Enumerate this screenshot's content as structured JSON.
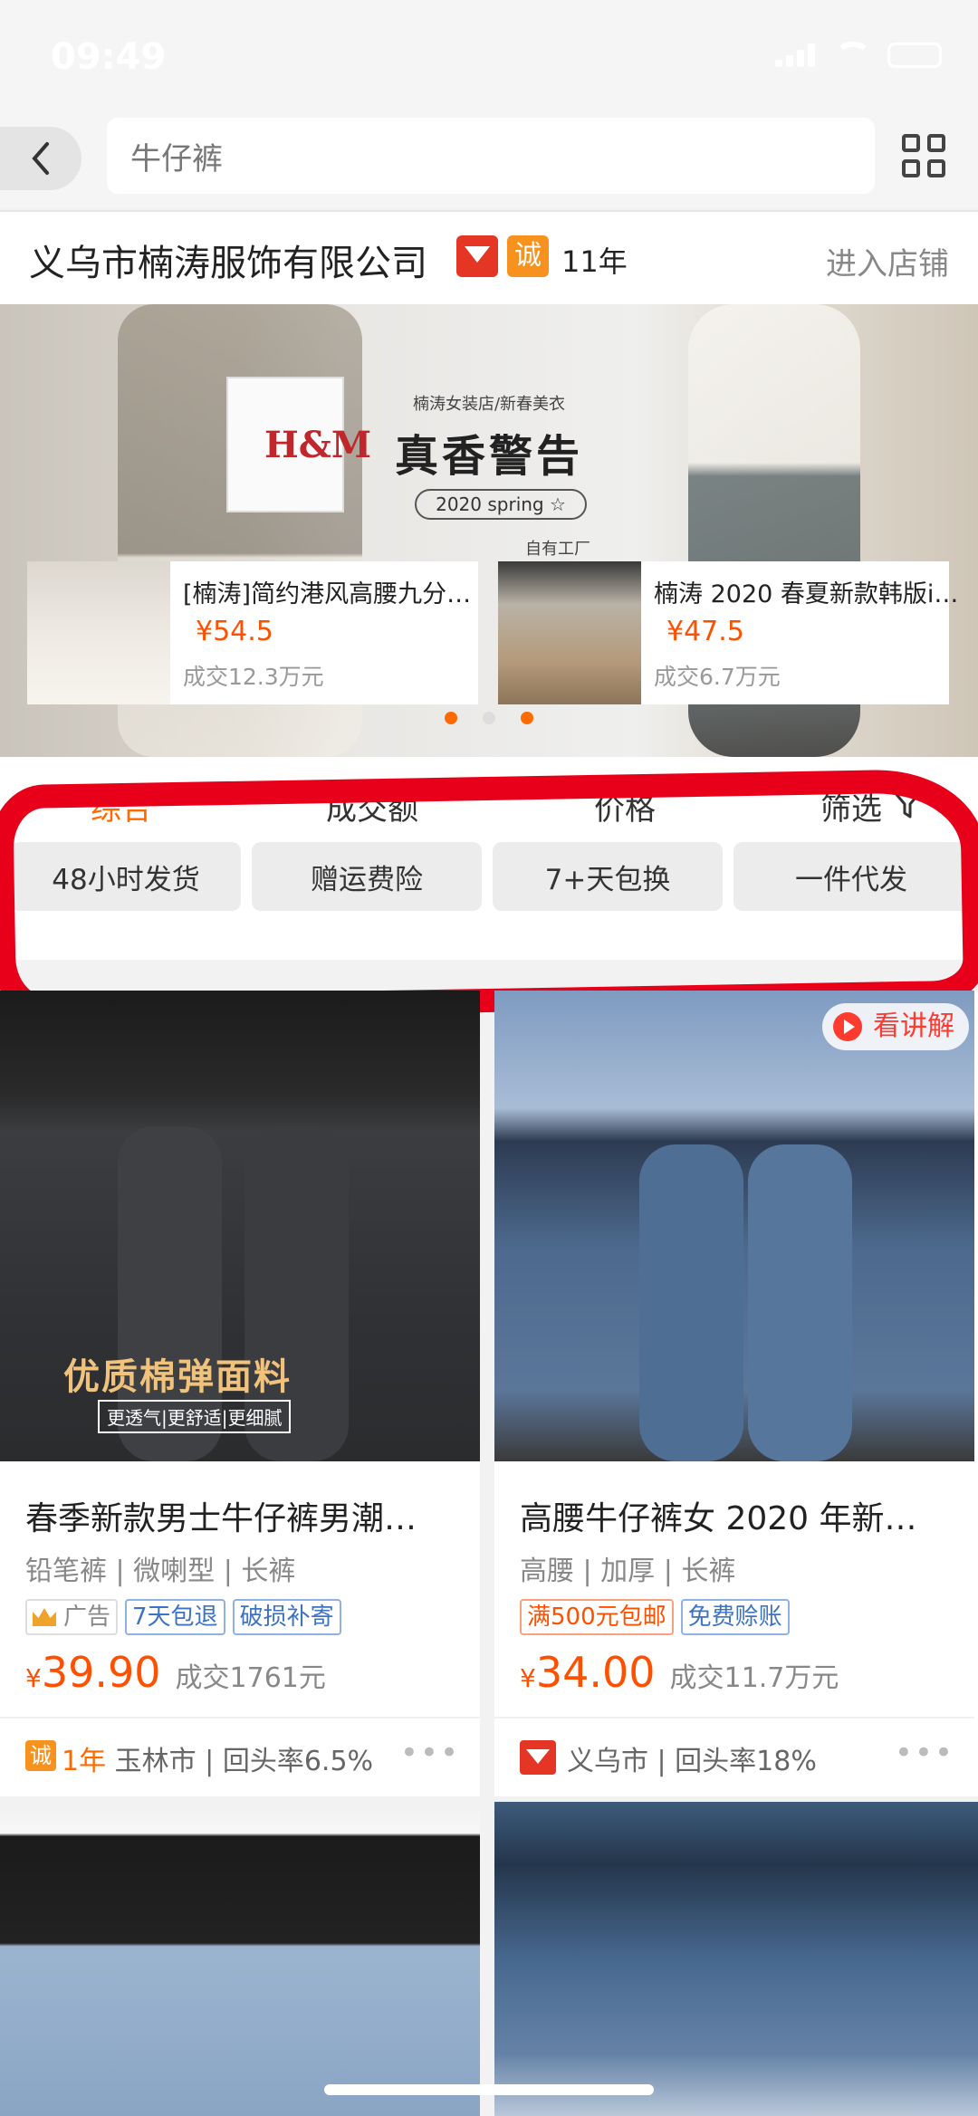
{
  "status_bar": {
    "time": "09:49"
  },
  "search": {
    "value": "牛仔裤"
  },
  "shop": {
    "name": "义乌市楠涛服饰有限公司",
    "cheng_badge": "诚",
    "years": "11年",
    "enter_label": "进入店铺"
  },
  "banner": {
    "subtitle": "楠涛女装店/新春美衣",
    "title": "真香警告",
    "pill": "2020 spring ☆",
    "extra": "自有工厂",
    "bag_brand": "H&M",
    "products": [
      {
        "title": "[楠涛]简约港风高腰九分…",
        "price": "¥54.5",
        "deal": "成交12.3万元"
      },
      {
        "title": "楠涛 2020 春夏新款韩版i…",
        "price": "¥47.5",
        "deal": "成交6.7万元"
      }
    ],
    "carousel_pages": 3,
    "carousel_active_index": 0
  },
  "sort_tabs": [
    "综合",
    "成交额",
    "价格",
    "筛选"
  ],
  "filter_chips": [
    "48小时发货",
    "赠运费险",
    "7+天包换",
    "一件代发"
  ],
  "products": [
    {
      "title": "春季新款男士牛仔裤男潮…",
      "attrs": "铅笔裤 | 微喇型 | 长裤",
      "image_text": "优质棉弹面料",
      "image_subtext": "更透气|更舒适|更细腻",
      "tags": [
        "广告",
        "7天包退",
        "破损补寄"
      ],
      "price_symbol": "¥",
      "price": "39.90",
      "deal": "成交1761元",
      "seller_years": "1年",
      "seller_info": "玉林市 | 回头率6.5%"
    },
    {
      "title": "高腰牛仔裤女 2020 年新…",
      "attrs": "高腰 | 加厚 | 长裤",
      "video_label": "看讲解",
      "tags": [
        "满500元包邮",
        "免费赊账"
      ],
      "price_symbol": "¥",
      "price": "34.00",
      "deal": "成交11.7万元",
      "seller_info": "义乌市 | 回头率18%"
    }
  ],
  "more_label": "•••",
  "colors": {
    "accent": "#ff6a00",
    "price": "#ff5000",
    "highlight_ring": "#e8001a"
  }
}
